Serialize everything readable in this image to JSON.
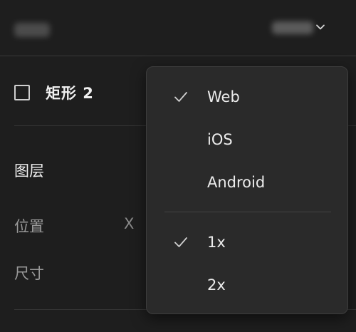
{
  "layer": {
    "name": "矩形 2"
  },
  "sections": {
    "layer_title": "图层",
    "position_label": "位置",
    "size_label": "尺寸",
    "x_label": "X"
  },
  "dropdown": {
    "platforms": [
      {
        "label": "Web",
        "checked": true
      },
      {
        "label": "iOS",
        "checked": false
      },
      {
        "label": "Android",
        "checked": false
      }
    ],
    "scales": [
      {
        "label": "1x",
        "checked": true
      },
      {
        "label": "2x",
        "checked": false
      }
    ]
  },
  "icons": {
    "topbar_chevron": "chevron-down-icon",
    "check": "checkmark-icon",
    "frame": "frame-checkbox-icon"
  },
  "colors": {
    "background": "#1e1e1e",
    "dropdown_bg": "#2a2a2a",
    "text_primary": "#ececec",
    "text_secondary": "#9a9a9a"
  }
}
